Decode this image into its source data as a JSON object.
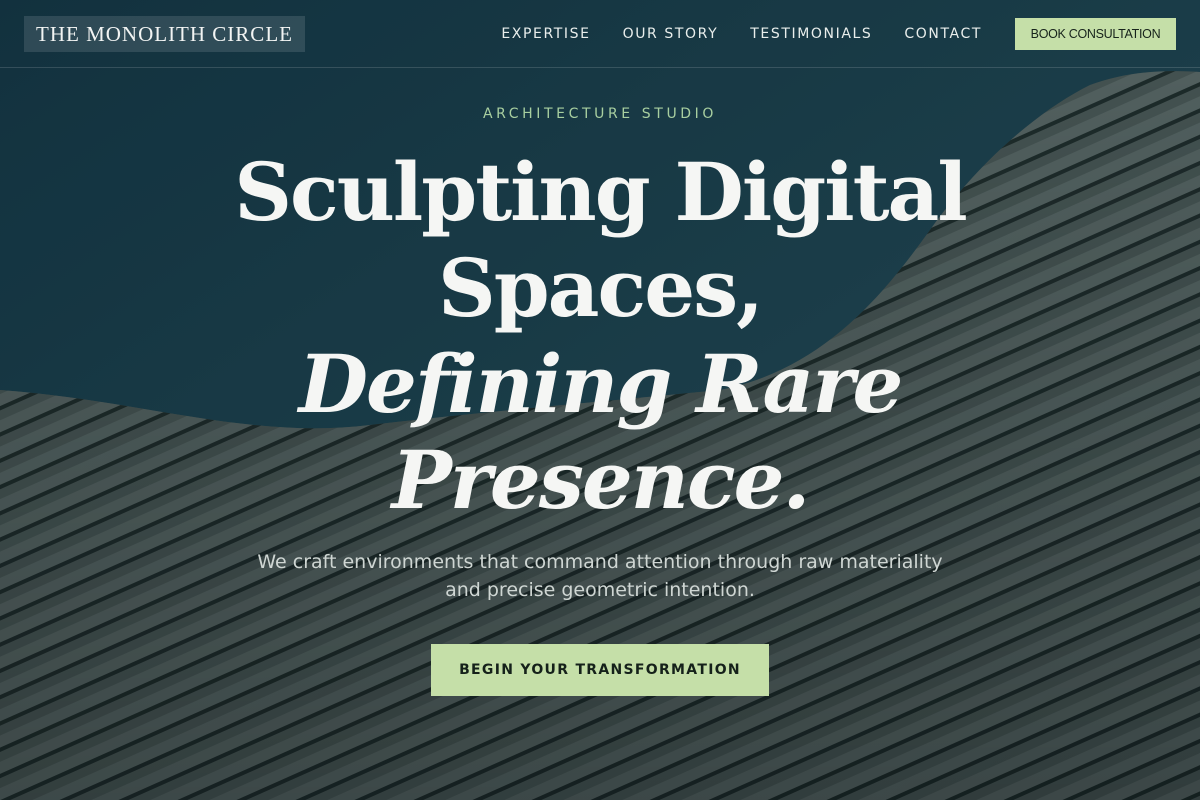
{
  "header": {
    "brand": "THE MONOLITH CIRCLE",
    "nav": [
      {
        "label": "EXPERTISE"
      },
      {
        "label": "OUR STORY"
      },
      {
        "label": "TESTIMONIALS"
      },
      {
        "label": "CONTACT"
      }
    ],
    "cta_label": "BOOK CONSULTATION"
  },
  "hero": {
    "eyebrow": "ARCHITECTURE STUDIO",
    "headline": {
      "line1": "Sculpting Digital",
      "line2": "Spaces,",
      "line3": "Defining Rare",
      "line4": "Presence."
    },
    "subtitle": "We craft environments that command attention through raw materiality and precise geometric intention.",
    "cta_label": "BEGIN YOUR TRANSFORMATION"
  },
  "colors": {
    "accent": "#c5dfa8",
    "eyebrow": "#a8cfa0",
    "sky": "#1d3a44",
    "facade": "#4c5a55",
    "text": "#f5f6f4"
  }
}
